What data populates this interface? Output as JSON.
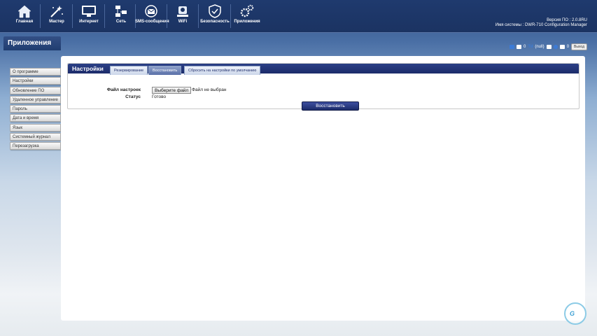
{
  "nav": {
    "items": [
      {
        "label": "Главная",
        "icon": "home-icon"
      },
      {
        "label": "Мастер",
        "icon": "wizard-icon"
      },
      {
        "label": "Интернет",
        "icon": "internet-icon"
      },
      {
        "label": "Сеть",
        "icon": "network-icon"
      },
      {
        "label": "SMS-сообщения",
        "icon": "sms-icon"
      },
      {
        "label": "WiFi",
        "icon": "wifi-icon"
      },
      {
        "label": "Безопасность",
        "icon": "security-icon"
      },
      {
        "label": "Приложения",
        "icon": "apps-icon"
      }
    ]
  },
  "system": {
    "version_line": "Версия ПО : 2.0.8RU",
    "name_line": "Имя системы : DWR-710 Configuration Manager"
  },
  "sidebar": {
    "title": "Приложения",
    "items": [
      {
        "label": "О программе"
      },
      {
        "label": "Настройки"
      },
      {
        "label": "Обновление ПО"
      },
      {
        "label": "Удаленное управление"
      },
      {
        "label": "Пароль"
      },
      {
        "label": "Дата и время"
      },
      {
        "label": "Язык"
      },
      {
        "label": "Системный журнал"
      },
      {
        "label": "Перезагрузка"
      }
    ]
  },
  "statusbar": {
    "sms_count": "0",
    "signal": "(null)",
    "wifi_count": "0",
    "logout": "Выход"
  },
  "settings": {
    "title": "Настройки",
    "tabs": [
      {
        "label": "Резервирование"
      },
      {
        "label": "Восстановить",
        "active": true
      },
      {
        "label": "Сбросить на настройки по умолчанию"
      }
    ],
    "file_label": "Файл настроек",
    "file_button": "Выберите файл",
    "file_status": "Файл не выбран",
    "status_label": "Статус",
    "status_value": "Готово",
    "restore_button": "Восстановить"
  },
  "colors": {
    "header": "#1f3a6e",
    "panel_header": "#1d2c6a",
    "active_tab": "#5a70a8"
  }
}
